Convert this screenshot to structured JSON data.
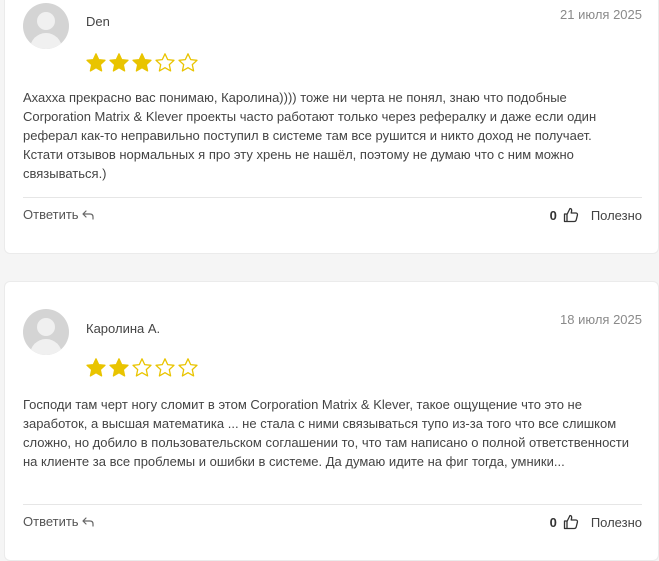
{
  "reviews": [
    {
      "author": "Den",
      "date": "21 июля 2025",
      "rating": 3,
      "max_rating": 5,
      "text": "Ахахха прекрасно вас понимаю, Каролина)))) тоже ни черта не понял, знаю что подобные Corporation Matrix & Klever проекты часто работают только через рефералку и даже если один реферал как-то неправильно поступил в системе там все рушится и никто доход не получает. Кстати отзывов нормальных я про эту хрень не нашёл, поэтому не думаю что с ним можно связываться.)",
      "reply_label": "Ответить",
      "likes": "0",
      "helpful_label": "Полезно"
    },
    {
      "author": "Каролина А.",
      "date": "18 июля 2025",
      "rating": 2,
      "max_rating": 5,
      "text": "Господи там черт ногу сломит в этом Corporation Matrix & Klever, такое ощущение что это не заработок, а высшая математика ... не стала с ними связываться тупо из-за того что все слишком сложно, но добило в пользовательском соглашении то, что там написано о полной ответственности на клиенте за все проблемы и ошибки в системе. Да думаю идите на фиг тогда, умники...",
      "reply_label": "Ответить",
      "likes": "0",
      "helpful_label": "Полезно"
    }
  ],
  "colors": {
    "star_filled": "#e9c400",
    "star_empty_stroke": "#e9c400",
    "page_bg": "#f5f5f5",
    "card_bg": "#ffffff"
  },
  "icons": {
    "reply": "reply-arrow-icon",
    "like": "thumbs-up-icon",
    "star": "star-icon",
    "avatar": "user-placeholder-avatar"
  }
}
